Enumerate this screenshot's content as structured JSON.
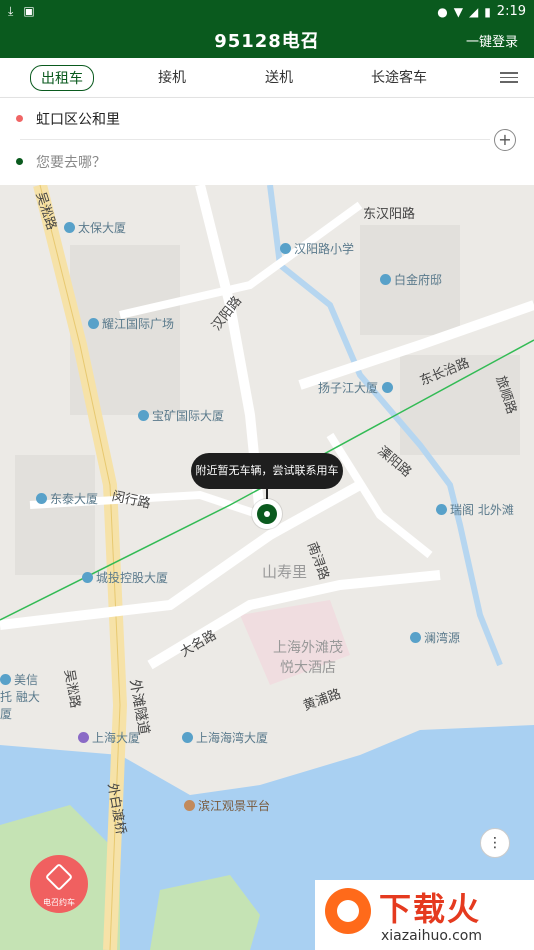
{
  "status_bar": {
    "time": "2:19",
    "icons": [
      "download-icon",
      "app-icon",
      "location-icon",
      "wifi-icon",
      "signal-icon",
      "battery-icon"
    ]
  },
  "header": {
    "title": "95128电召",
    "login": "一键登录"
  },
  "tabs": [
    {
      "label": "出租车",
      "active": true
    },
    {
      "label": "接机",
      "active": false
    },
    {
      "label": "送机",
      "active": false
    },
    {
      "label": "长途客车",
      "active": false
    }
  ],
  "address": {
    "from": "虹口区公和里",
    "to_placeholder": "您要去哪？"
  },
  "map": {
    "tooltip": "附近暂无车辆，尝试联系用车",
    "roads": [
      "东汉阳路",
      "吴淞路",
      "汉阳路",
      "东长治路",
      "闵行路",
      "溧阳路",
      "南浔路",
      "大名路",
      "黄浦路",
      "外滩隧道",
      "外白渡桥",
      "吴淞路",
      "旅顺路"
    ],
    "pois": [
      "太保大厦",
      "汉阳路小学",
      "白金府邸",
      "耀江国际广场",
      "扬子江大厦",
      "宝矿国际大厦",
      "东泰大厦",
      "瑞阁",
      "北外滩",
      "城投控股大厦",
      "山寿里",
      "上海外滩茂悦大酒店",
      "澜湾源",
      "美信托 融大厦",
      "上海大厦",
      "上海海湾大厦",
      "滨江观景平台"
    ]
  },
  "fab": {
    "label": "电召约车"
  },
  "watermark": {
    "brand": "下载火",
    "url": "xiazaihuo.com"
  },
  "colors": {
    "primary": "#0a5a1e",
    "origin_dot": "#f06565",
    "fab": "#f06060"
  }
}
